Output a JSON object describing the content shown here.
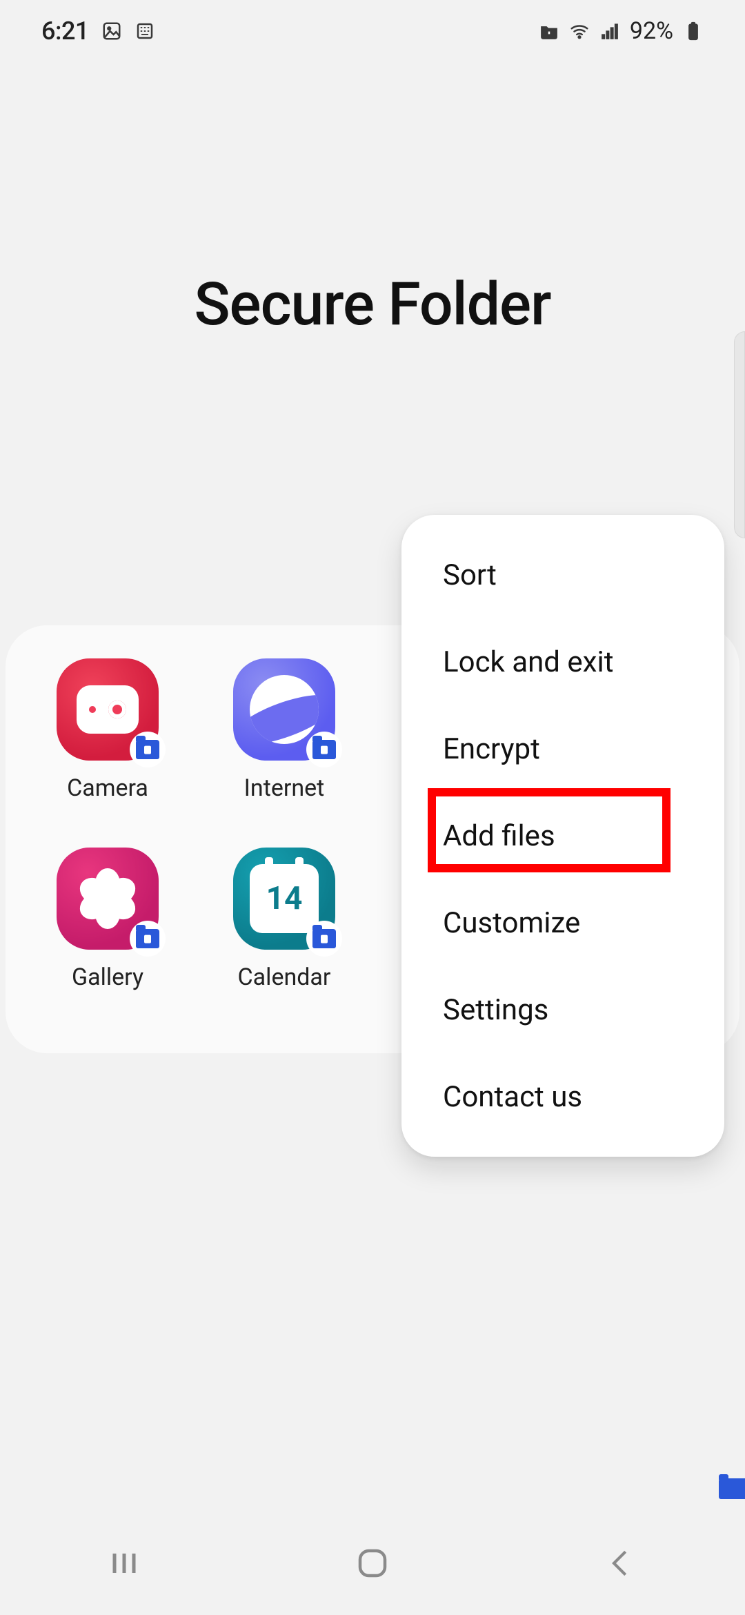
{
  "status_bar": {
    "time": "6:21",
    "battery_pct": "92%"
  },
  "page": {
    "title": "Secure Folder"
  },
  "apps": [
    {
      "id": "camera",
      "label": "Camera"
    },
    {
      "id": "internet",
      "label": "Internet"
    },
    {
      "id": "gallery",
      "label": "Gallery"
    },
    {
      "id": "calendar",
      "label": "Calendar",
      "day": "14"
    }
  ],
  "menu": {
    "items": [
      "Sort",
      "Lock and exit",
      "Encrypt",
      "Add files",
      "Customize",
      "Settings",
      "Contact us"
    ],
    "highlighted_index": 3
  }
}
